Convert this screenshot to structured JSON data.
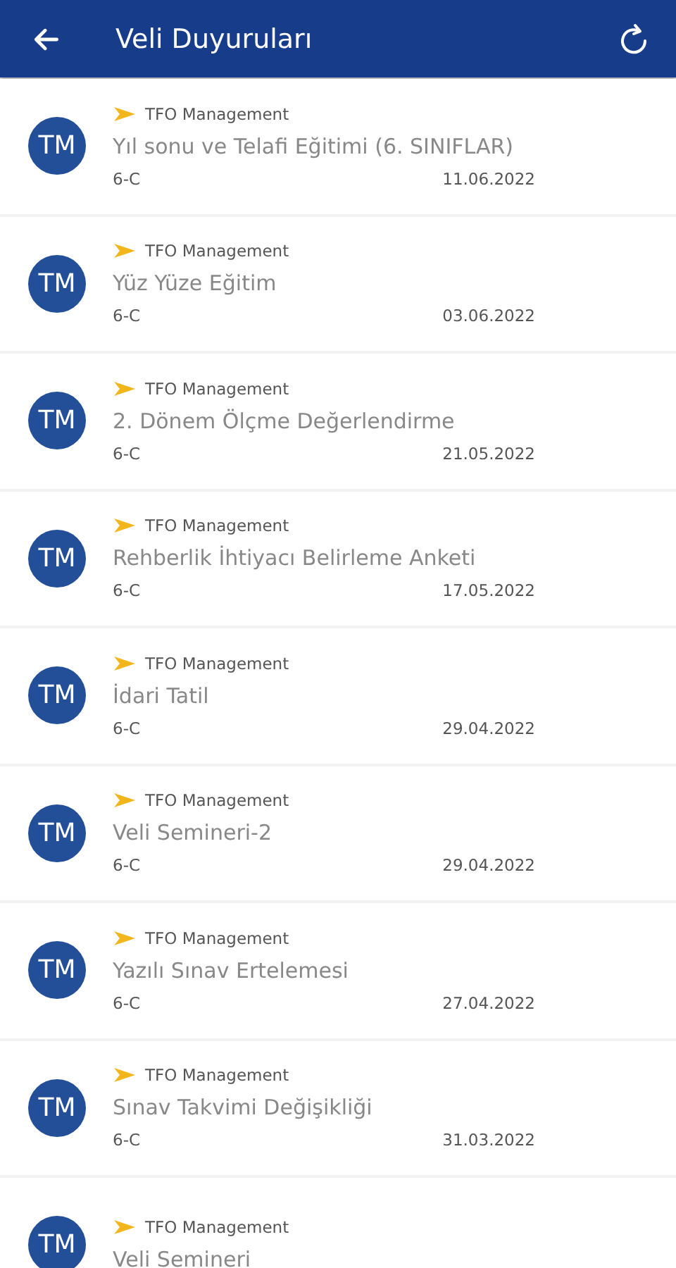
{
  "header": {
    "title": "Veli Duyuruları"
  },
  "announcements": [
    {
      "avatar": "TM",
      "sender": "TFO Management",
      "title": "Yıl sonu ve Telafi Eğitimi (6. SINIFLAR)",
      "class": "6-C",
      "date": "11.06.2022"
    },
    {
      "avatar": "TM",
      "sender": "TFO Management",
      "title": "Yüz Yüze Eğitim",
      "class": "6-C",
      "date": "03.06.2022"
    },
    {
      "avatar": "TM",
      "sender": "TFO Management",
      "title": "2. Dönem Ölçme Değerlendirme",
      "class": "6-C",
      "date": "21.05.2022"
    },
    {
      "avatar": "TM",
      "sender": "TFO Management",
      "title": "Rehberlik İhtiyacı Belirleme Anketi",
      "class": "6-C",
      "date": "17.05.2022"
    },
    {
      "avatar": "TM",
      "sender": "TFO Management",
      "title": "İdari Tatil",
      "class": "6-C",
      "date": "29.04.2022"
    },
    {
      "avatar": "TM",
      "sender": "TFO Management",
      "title": "Veli Semineri-2",
      "class": "6-C",
      "date": "29.04.2022"
    },
    {
      "avatar": "TM",
      "sender": "TFO Management",
      "title": "Yazılı Sınav Ertelemesi",
      "class": "6-C",
      "date": "27.04.2022"
    },
    {
      "avatar": "TM",
      "sender": "TFO Management",
      "title": "Sınav Takvimi Değişikliği",
      "class": "6-C",
      "date": "31.03.2022"
    },
    {
      "avatar": "TM",
      "sender": "TFO Management",
      "title": "Veli Semineri"
    }
  ]
}
